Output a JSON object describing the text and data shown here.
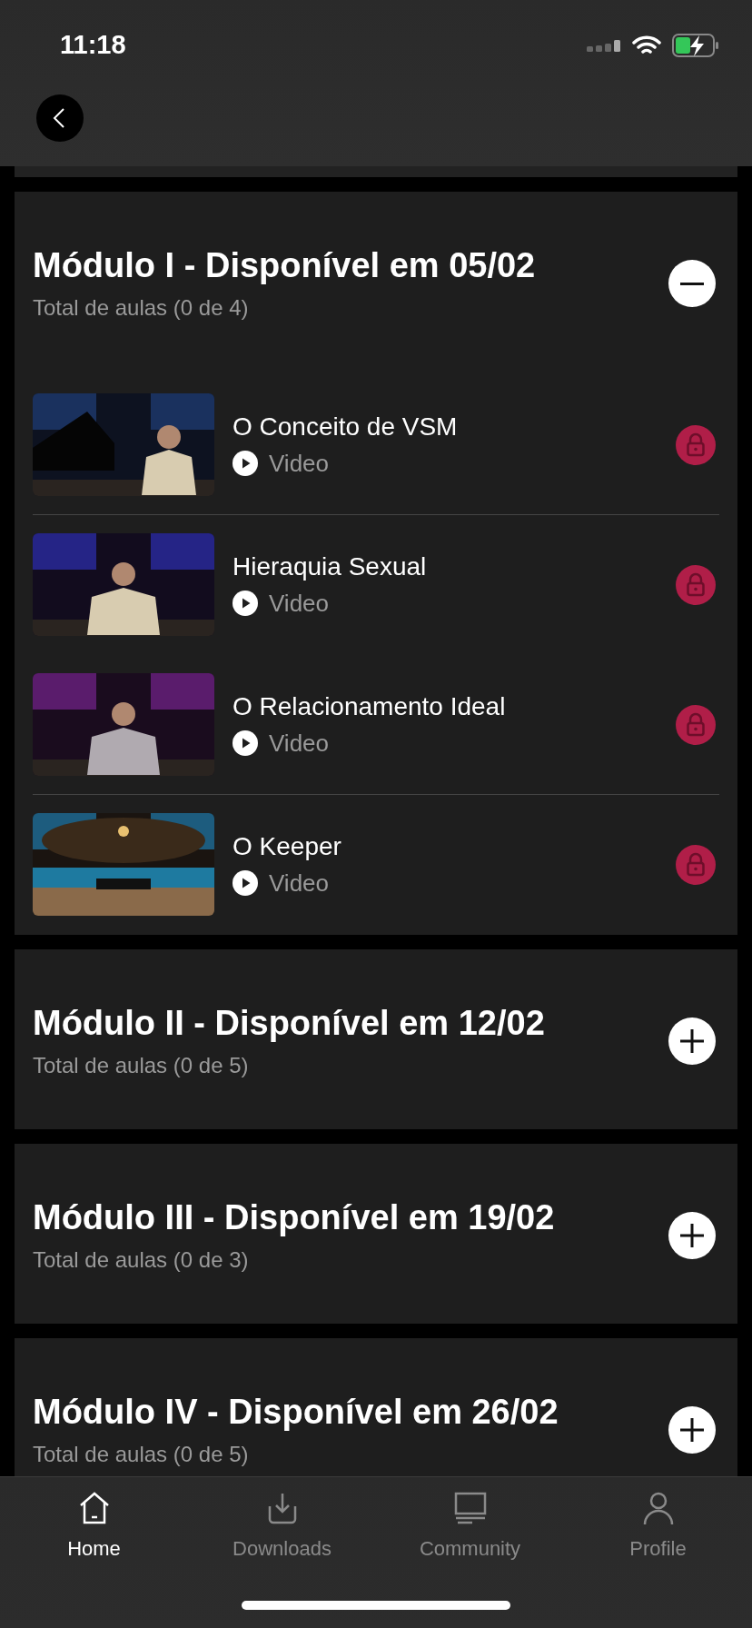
{
  "status_bar": {
    "time": "11:18"
  },
  "modules": [
    {
      "title": "Módulo I - Disponível em 05/02",
      "subtitle": "Total de aulas (0 de 4)",
      "expanded": true,
      "lessons": [
        {
          "title": "O Conceito de VSM",
          "type": "Video",
          "locked": true,
          "divider_below": true
        },
        {
          "title": "Hieraquia Sexual",
          "type": "Video",
          "locked": true,
          "divider_below": false
        },
        {
          "title": "O Relacionamento Ideal",
          "type": "Video",
          "locked": true,
          "divider_below": true
        },
        {
          "title": "O Keeper",
          "type": "Video",
          "locked": true,
          "divider_below": false
        }
      ]
    },
    {
      "title": "Módulo II - Disponível em 12/02",
      "subtitle": "Total de aulas (0 de 5)",
      "expanded": false
    },
    {
      "title": "Módulo III - Disponível em 19/02",
      "subtitle": "Total de aulas (0 de 3)",
      "expanded": false
    },
    {
      "title": "Módulo IV - Disponível em 26/02",
      "subtitle": "Total de aulas (0 de 5)",
      "expanded": false
    }
  ],
  "tab_bar": [
    {
      "label": "Home",
      "selected": true
    },
    {
      "label": "Downloads",
      "selected": false
    },
    {
      "label": "Community",
      "selected": false
    },
    {
      "label": "Profile",
      "selected": false
    }
  ]
}
